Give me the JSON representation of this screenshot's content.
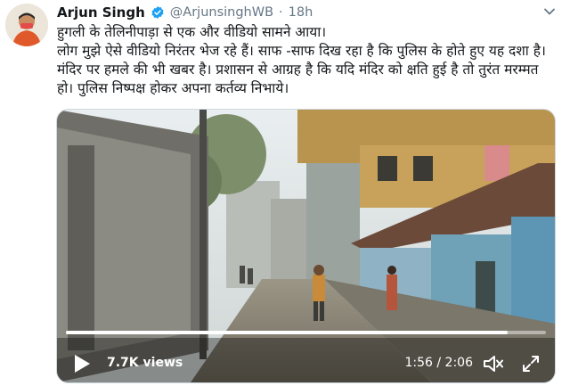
{
  "tweet": {
    "display_name": "Arjun Singh",
    "handle": "@ArjunsinghWB",
    "separator": "·",
    "time": "18h",
    "line1": "हुगली के तेलिनीपाड़ा से एक और वीडियो सामने आया।",
    "line2": "लोग मुझे ऐसे वीडियो निरंतर भेज रहे हैं। साफ -साफ दिख रहा है कि पुलिस के होते हुए यह दशा है। मंदिर पर हमले की भी खबर है। प्रशासन से आग्रह है कि यदि मंदिर को क्षति हुई है तो तुरंत मरम्मत हो। पुलिस निष्पक्ष होकर अपना कर्तव्य निभाये।"
  },
  "video": {
    "views": "7.7K views",
    "timecode": "1:56 / 2:06",
    "progress": 0.92
  },
  "colors": {
    "verified": "#1da1f2",
    "secondary_text": "#657786"
  },
  "icons": [
    "verified-badge-icon",
    "chevron-down-icon",
    "play-icon",
    "volume-icon",
    "fullscreen-icon"
  ]
}
